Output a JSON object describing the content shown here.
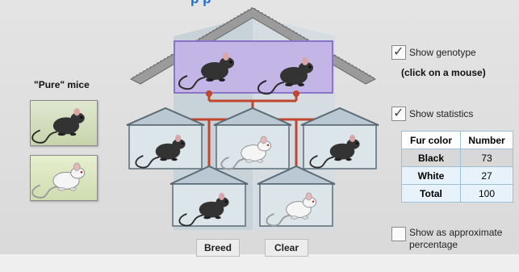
{
  "header": {
    "title": "p p"
  },
  "pure_mice": {
    "label": "\"Pure\" mice",
    "cards": [
      "black-mouse",
      "white-mouse"
    ]
  },
  "controls": {
    "breed_label": "Breed",
    "clear_label": "Clear",
    "show_genotype": {
      "label": "Show genotype",
      "checked": true
    },
    "genotype_note": "(click on a mouse)",
    "show_statistics": {
      "label": "Show statistics",
      "checked": true
    },
    "show_percentage": {
      "label_line1": "Show as approximate",
      "label_line2": "percentage",
      "checked": false
    }
  },
  "statistics": {
    "headers": [
      "Fur color",
      "Number"
    ],
    "rows": [
      {
        "label": "Black",
        "value": "73"
      },
      {
        "label": "White",
        "value": "27"
      },
      {
        "label": "Total",
        "value": "100"
      }
    ]
  },
  "house": {
    "parents": [
      "black",
      "black"
    ],
    "children_row1": [
      "black",
      "white",
      "black"
    ],
    "children_row2": [
      "black",
      "white"
    ]
  },
  "colors": {
    "accent": "#1f6fd0",
    "line": "#c0462e",
    "selection": "#c3b6e6"
  }
}
